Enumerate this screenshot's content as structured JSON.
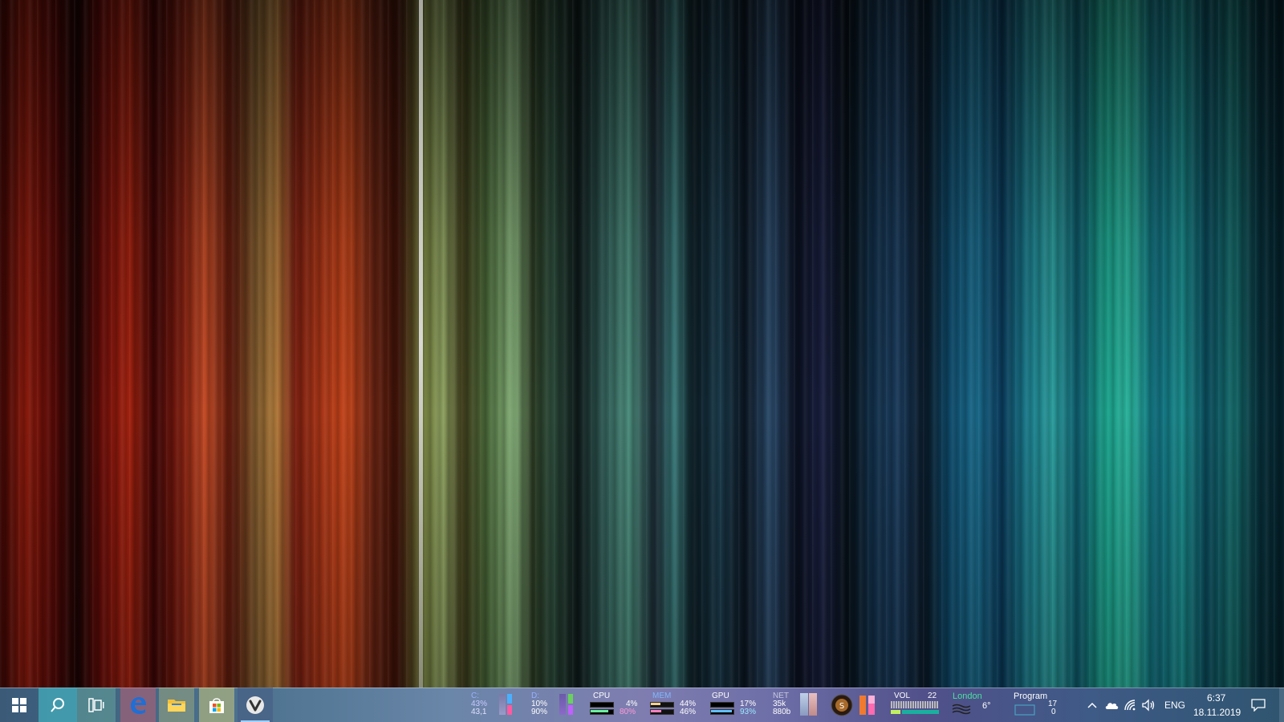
{
  "desktop": {
    "wallpaper": "vertical-color-streaks"
  },
  "taskbar": {
    "pinned": [
      {
        "name": "start",
        "icon": "windows-logo-icon"
      },
      {
        "name": "search",
        "icon": "search-icon"
      },
      {
        "name": "task-view",
        "icon": "task-view-icon"
      },
      {
        "name": "edge",
        "icon": "edge-browser-icon"
      },
      {
        "name": "file-explorer",
        "icon": "folder-icon"
      },
      {
        "name": "store",
        "icon": "store-bag-icon"
      },
      {
        "name": "vivaldi",
        "icon": "vivaldi-icon"
      }
    ]
  },
  "widgets": {
    "disk_c": {
      "label": "C:",
      "line1": "43%",
      "line2": "43,1"
    },
    "disk_d": {
      "label": "D:",
      "line1": "10%",
      "line2": "90%"
    },
    "cpu": {
      "label": "CPU",
      "v1": "4%",
      "v2": "80%"
    },
    "mem": {
      "label": "MEM",
      "v1": "44%",
      "v2": "46%"
    },
    "gpu": {
      "label": "GPU",
      "v1": "17%",
      "v2": "93%"
    },
    "net": {
      "label": "NET",
      "v1": "35k",
      "v2": "880b"
    },
    "vol": {
      "label": "VOL",
      "value": "22"
    },
    "weather": {
      "city": "London",
      "temp": "6°"
    },
    "program": {
      "label": "Program",
      "v1": "17",
      "v2": "0"
    }
  },
  "tray": {
    "language": "ENG",
    "time": "6:37",
    "date": "18.11.2019"
  },
  "colors": {
    "disk_label": "#9ab0ff",
    "cpu_label": "#ffffff",
    "mem_label": "#7fb8ff",
    "gpu_label": "#ffffff",
    "net_label": "#c8c8e0",
    "weather_city": "#4be0a0",
    "value_pink": "#ff9ad8",
    "value_cyan": "#9ae8ff"
  }
}
